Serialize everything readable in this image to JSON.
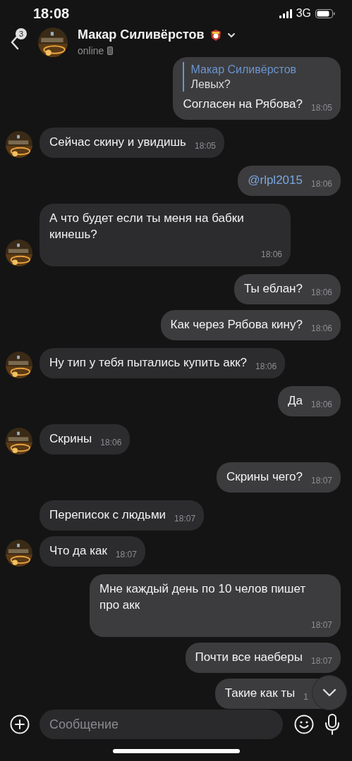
{
  "status_bar": {
    "time": "18:08",
    "network": "3G"
  },
  "header": {
    "unread_count": "3",
    "name": "Макар Силивёрстов",
    "status": "online"
  },
  "messages": [
    {
      "outgoing": true,
      "kind": "reply",
      "reply_author": "Макар Силивёрстов",
      "reply_text": "Левых?",
      "text": "Согласен на Рябова?",
      "time": "18:05",
      "avatar": false
    },
    {
      "outgoing": false,
      "kind": "text",
      "text": "Сейчас скину и увидишь",
      "time": "18:05",
      "avatar": true
    },
    {
      "outgoing": true,
      "kind": "mention",
      "text": "@rlpl2015",
      "time": "18:06",
      "avatar": false
    },
    {
      "outgoing": false,
      "kind": "text",
      "text": "А что будет если ты меня на бабки кинешь?",
      "time": "18:06",
      "avatar": true
    },
    {
      "outgoing": true,
      "kind": "text",
      "text": "Ты еблан?",
      "time": "18:06",
      "avatar": false
    },
    {
      "outgoing": true,
      "kind": "text",
      "text": "Как через Рябова кину?",
      "time": "18:06",
      "avatar": false
    },
    {
      "outgoing": false,
      "kind": "text",
      "text": "Ну тип у тебя пытались купить акк?",
      "time": "18:06",
      "avatar": true
    },
    {
      "outgoing": true,
      "kind": "text",
      "text": "Да",
      "time": "18:06",
      "avatar": false
    },
    {
      "outgoing": false,
      "kind": "text",
      "text": "Скрины",
      "time": "18:06",
      "avatar": true
    },
    {
      "outgoing": true,
      "kind": "text",
      "text": "Скрины чего?",
      "time": "18:07",
      "avatar": false
    },
    {
      "outgoing": false,
      "kind": "text",
      "text": "Переписок с людьми",
      "time": "18:07",
      "avatar": false
    },
    {
      "outgoing": false,
      "kind": "text",
      "text": "Что да как",
      "time": "18:07",
      "avatar": true
    },
    {
      "outgoing": true,
      "kind": "text",
      "text": "Мне каждый день по 10 челов пишет про акк",
      "time": "18:07",
      "avatar": false
    },
    {
      "outgoing": true,
      "kind": "text",
      "text": "Почти все наеберы",
      "time": "18:07",
      "avatar": false
    },
    {
      "outgoing": true,
      "kind": "text",
      "text": "Такие как ты",
      "time": "1",
      "avatar": false
    }
  ],
  "composer": {
    "placeholder": "Сообщение"
  }
}
